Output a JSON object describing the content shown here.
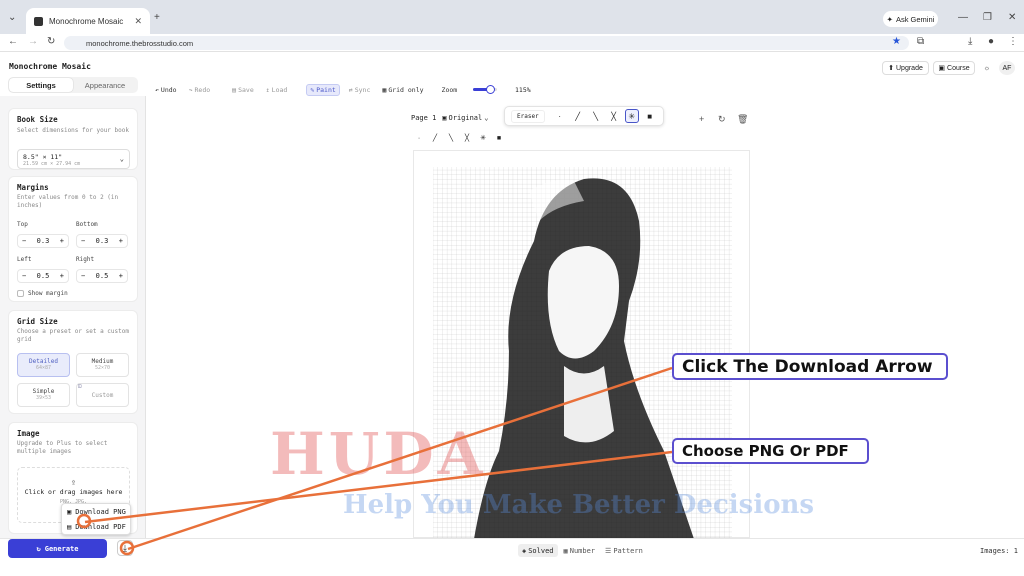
{
  "browser": {
    "tab_title": "Monochrome Mosaic",
    "new_tab": "+",
    "ask_gemini": "Ask Gemini",
    "url": "monochrome.thebrosstudio.com"
  },
  "app": {
    "name": "Monochrome Mosaic",
    "tabs": [
      "Settings",
      "Appearance"
    ],
    "upgrade": "Upgrade",
    "course": "Course",
    "avatar": "AF"
  },
  "toolbar": {
    "undo": "Undo",
    "redo": "Redo",
    "save": "Save",
    "load": "Load",
    "paint": "Paint",
    "sync": "Sync",
    "grid_only": "Grid only",
    "zoom_label": "Zoom",
    "zoom_value": "115%",
    "zoom_fraction": 0.7
  },
  "book": {
    "title": "Book Size",
    "subtitle": "Select dimensions for your book",
    "size": "8.5\" × 11\"",
    "size_metric": "21.59 cm × 27.94 cm"
  },
  "margins": {
    "title": "Margins",
    "subtitle": "Enter values from 0 to 2 (in inches)",
    "top_label": "Top",
    "top": "0.3",
    "bottom_label": "Bottom",
    "bottom": "0.3",
    "left_label": "Left",
    "left": "0.5",
    "right_label": "Right",
    "right": "0.5",
    "show_margin": "Show margin"
  },
  "grid": {
    "title": "Grid Size",
    "subtitle": "Choose a preset or set a custom grid",
    "detailed": "Detailed",
    "detailed_dim": "64×87",
    "medium": "Medium",
    "medium_dim": "52×70",
    "simple": "Simple",
    "simple_dim": "39×53",
    "custom": "Custom"
  },
  "image": {
    "title": "Image",
    "subtitle": "Upgrade to Plus to select multiple images",
    "drop_text": "Click or drag images here",
    "formats": "PNG, JPG,"
  },
  "menu": {
    "download_png": "Download PNG",
    "download_pdf": "Download PDF"
  },
  "generate": "Generate",
  "canvas": {
    "page": "Page 1",
    "original": "Original",
    "eraser": "Eraser"
  },
  "bottom": {
    "solved": "Solved",
    "number": "Number",
    "pattern": "Pattern",
    "images": "Images: 1"
  },
  "callouts": {
    "arrow": "Click The Download Arrow",
    "format": "Choose PNG Or PDF"
  },
  "watermark": {
    "main": "HUDA",
    "tag": "Help You Make Better Decisions"
  },
  "colors": {
    "accent": "#3a3fd6",
    "callout_border": "#5b4fcf",
    "arrow": "#e8703a"
  }
}
